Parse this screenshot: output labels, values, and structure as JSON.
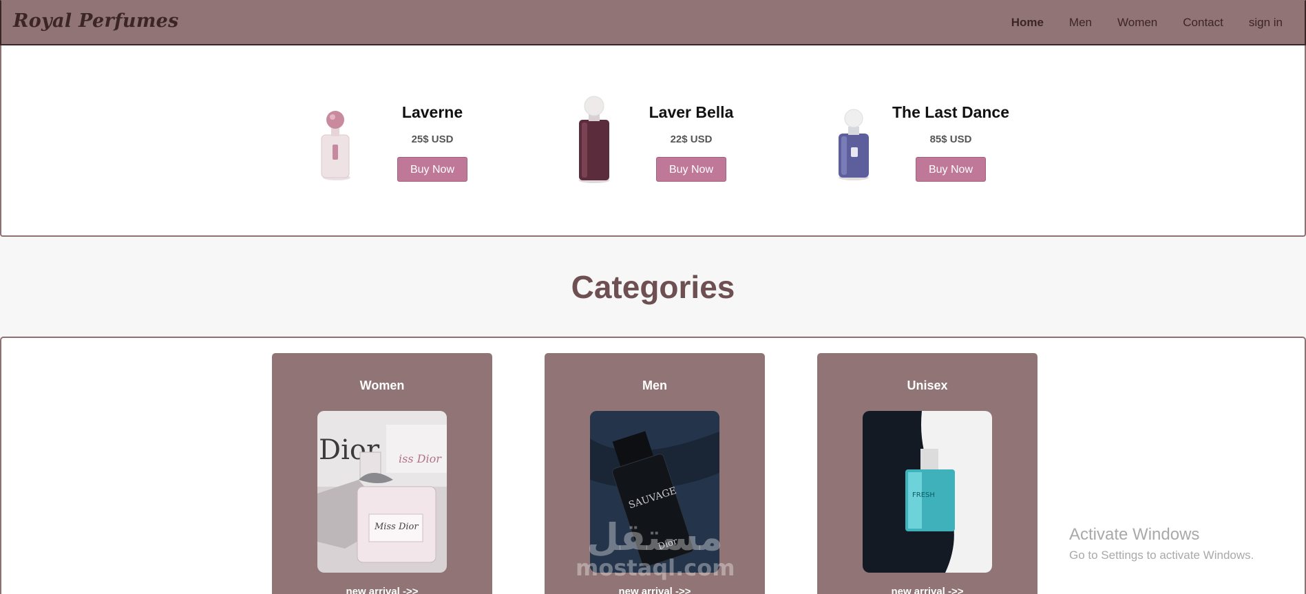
{
  "brand": "Royal Perfumes",
  "nav": {
    "items": [
      {
        "label": "Home",
        "active": true
      },
      {
        "label": "Men"
      },
      {
        "label": "Women"
      },
      {
        "label": "Contact"
      },
      {
        "label": "sign in"
      }
    ]
  },
  "products": [
    {
      "name": "Laverne",
      "price": "25$ USD",
      "button": "Buy Now",
      "bottle_color": "#e4c9cf"
    },
    {
      "name": "Laver Bella",
      "price": "22$ USD",
      "button": "Buy Now",
      "bottle_color": "#5a2d3a"
    },
    {
      "name": "The Last Dance",
      "price": "85$ USD",
      "button": "Buy Now",
      "bottle_color": "#5a5c9a"
    }
  ],
  "categories": {
    "title": "Categories",
    "cards": [
      {
        "title": "Women",
        "link": "new arrival ->>"
      },
      {
        "title": "Men",
        "link": "new arrival ->>"
      },
      {
        "title": "Unisex",
        "link": "new arrival ->>"
      }
    ]
  },
  "watermark": {
    "arabic": "مستقل",
    "latin": "mostaql.com"
  },
  "os_notice": {
    "title": "Activate Windows",
    "subtitle": "Go to Settings to activate Windows."
  },
  "colors": {
    "nav_bg": "#917475",
    "accent": "#bf7898",
    "card_bg": "#917475",
    "title": "#6e5052"
  }
}
